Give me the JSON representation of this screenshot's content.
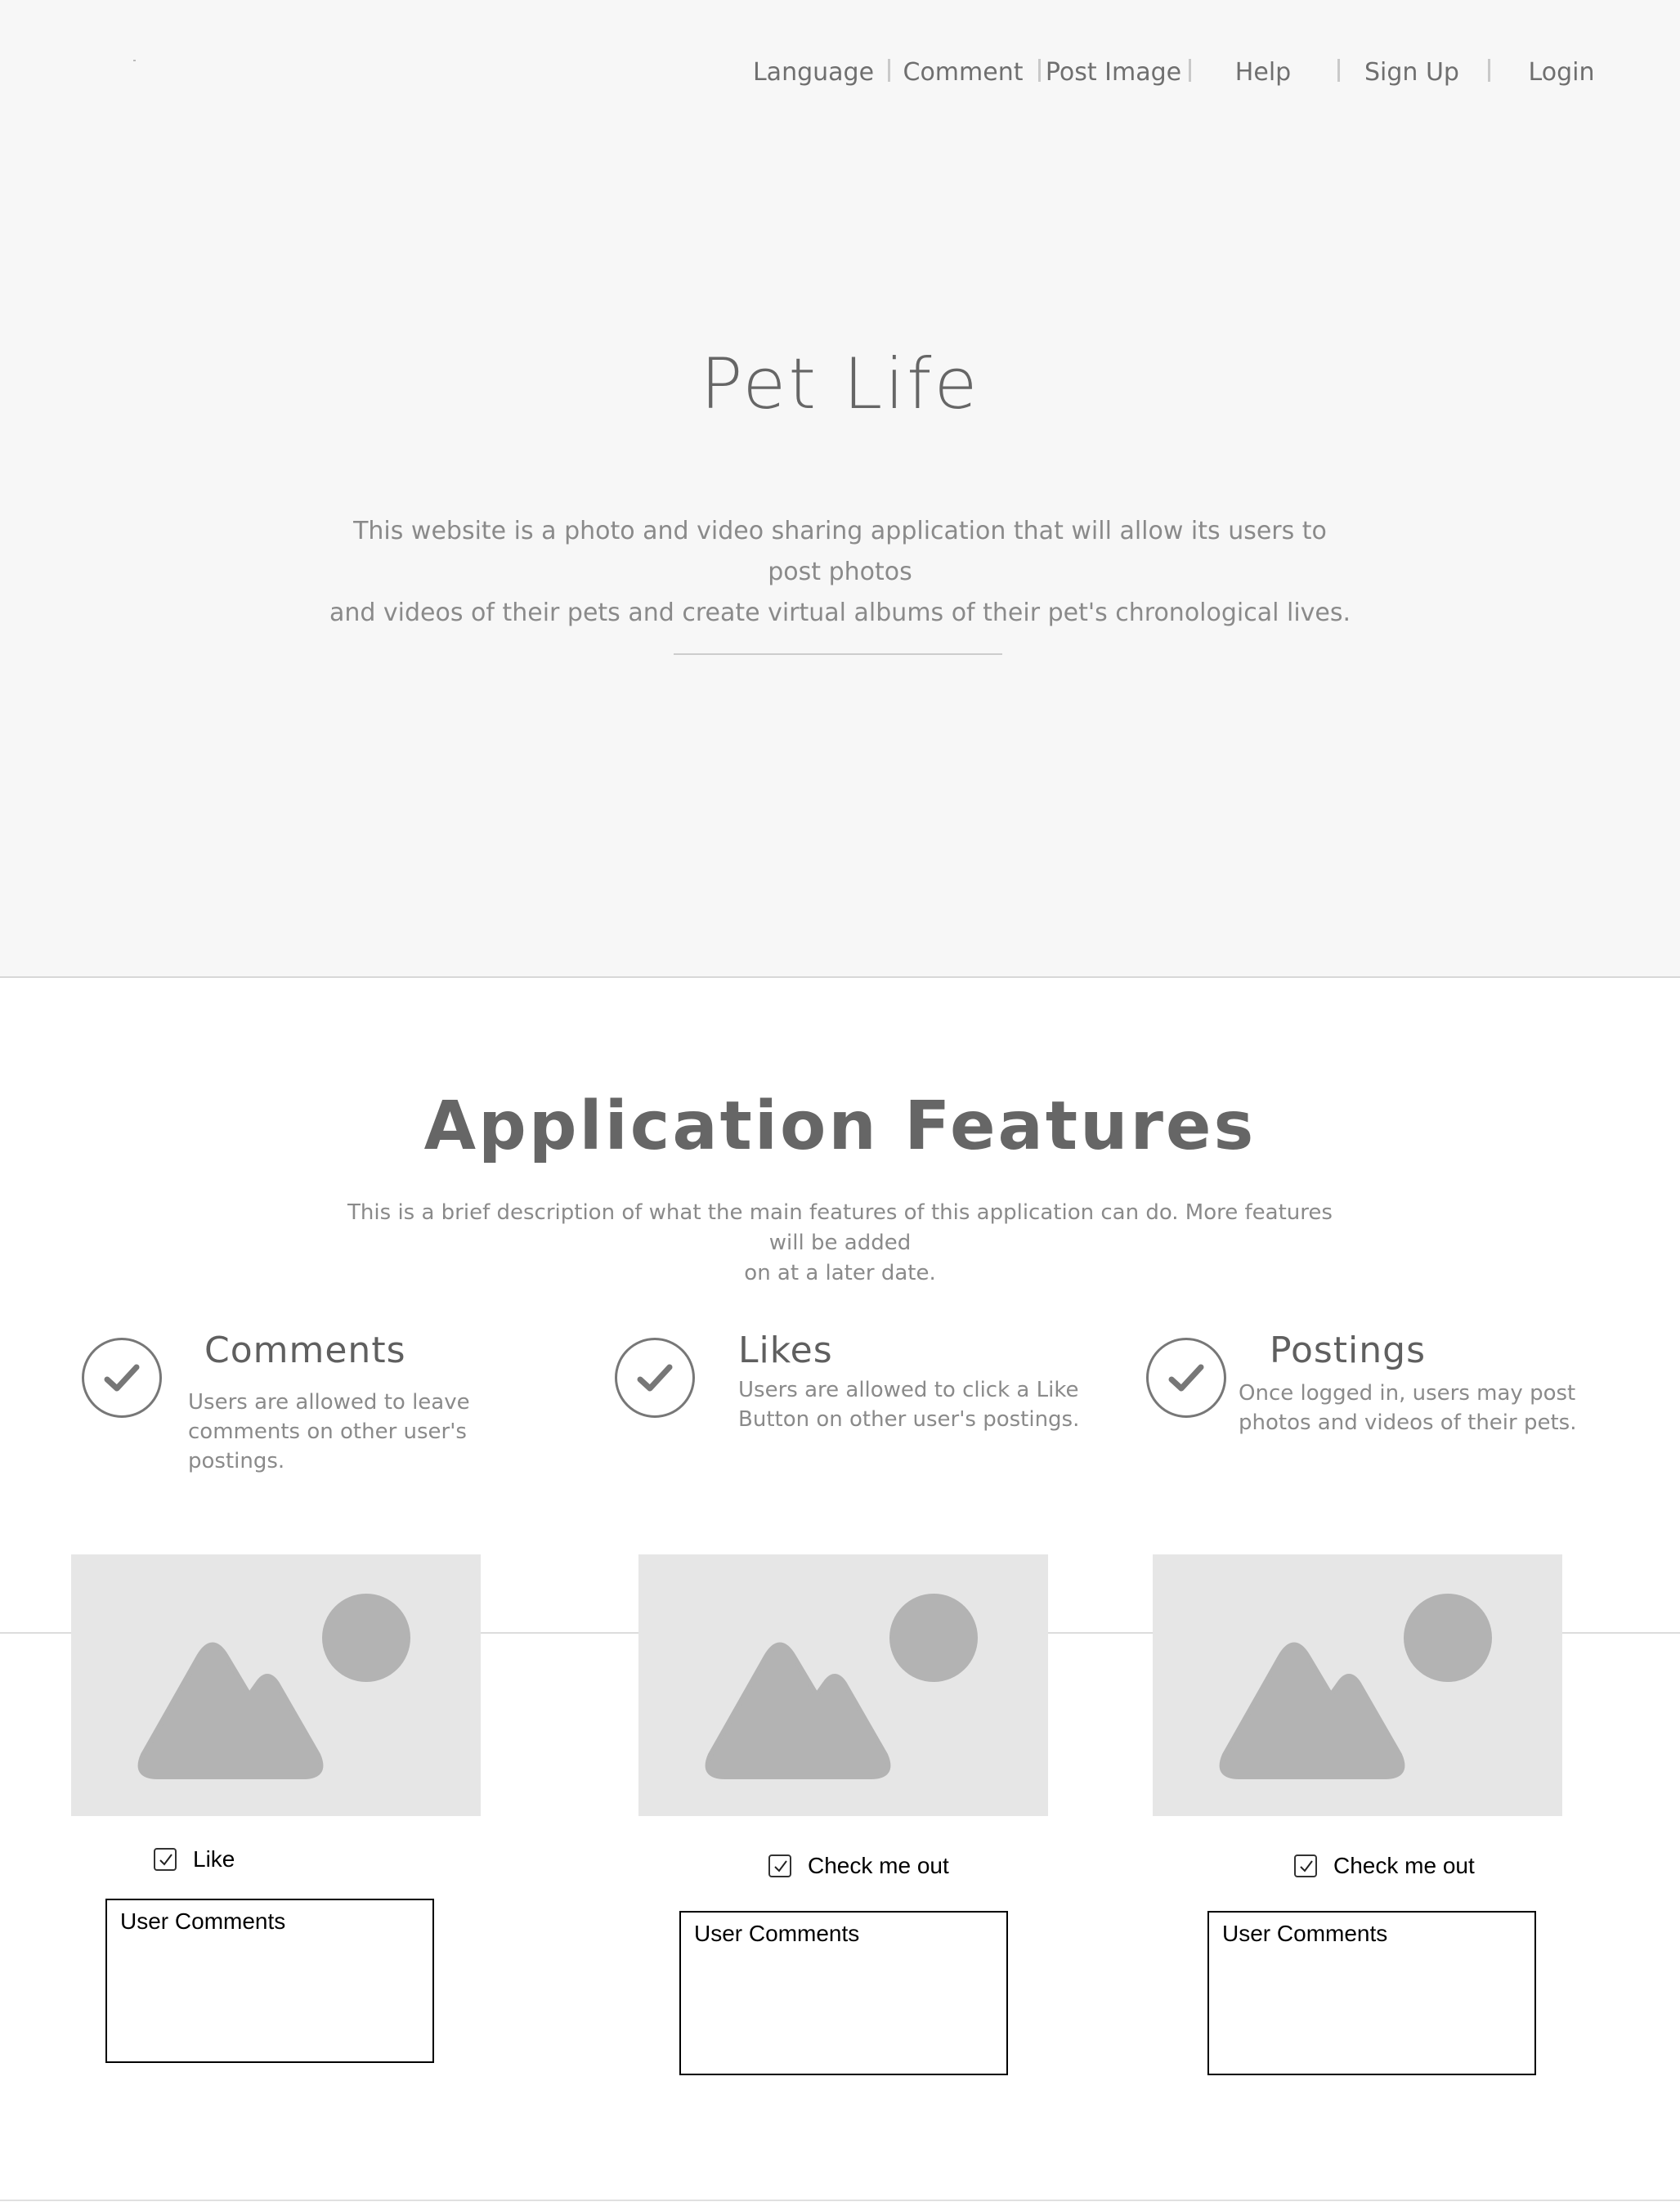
{
  "nav": {
    "items": [
      {
        "label": "Language"
      },
      {
        "label": "Comment"
      },
      {
        "label": "Post Image"
      },
      {
        "label": "Help"
      },
      {
        "label": "Sign Up"
      },
      {
        "label": "Login"
      }
    ]
  },
  "hero": {
    "title": "Pet Life",
    "description_line1": "This website is a photo and video sharing  application that will allow its users to post photos",
    "description_line2": "and videos of their pets and create virtual albums of their pet's chronological lives."
  },
  "features": {
    "title": "Application Features",
    "description_line1": "This is a brief description of what the main features of this application can do. More features will be added",
    "description_line2": "on at a later date.",
    "items": [
      {
        "icon": "check-icon",
        "title": "Comments",
        "lines": [
          "Users are allowed to leave",
          "comments on other user's",
          "postings."
        ]
      },
      {
        "icon": "check-icon",
        "title": "Likes",
        "lines": [
          "Users are allowed to click a Like",
          "Button on other user's postings."
        ]
      },
      {
        "icon": "check-icon",
        "title": "Postings",
        "lines": [
          "Once logged in, users may post",
          "photos and videos of their pets."
        ]
      }
    ]
  },
  "posts": [
    {
      "image_icon": "image-placeholder-icon",
      "checkbox_label": "Like",
      "checked": true,
      "comments_placeholder": "User Comments"
    },
    {
      "image_icon": "image-placeholder-icon",
      "checkbox_label": "Check me out",
      "checked": true,
      "comments_placeholder": "User Comments"
    },
    {
      "image_icon": "image-placeholder-icon",
      "checkbox_label": "Check me out",
      "checked": true,
      "comments_placeholder": "User Comments"
    }
  ],
  "colors": {
    "hero_background": "#f7f7f7",
    "text_primary": "#666666",
    "text_secondary": "#8a8a8a",
    "placeholder_background": "#e6e6e6",
    "placeholder_shape": "#b3b3b3"
  }
}
